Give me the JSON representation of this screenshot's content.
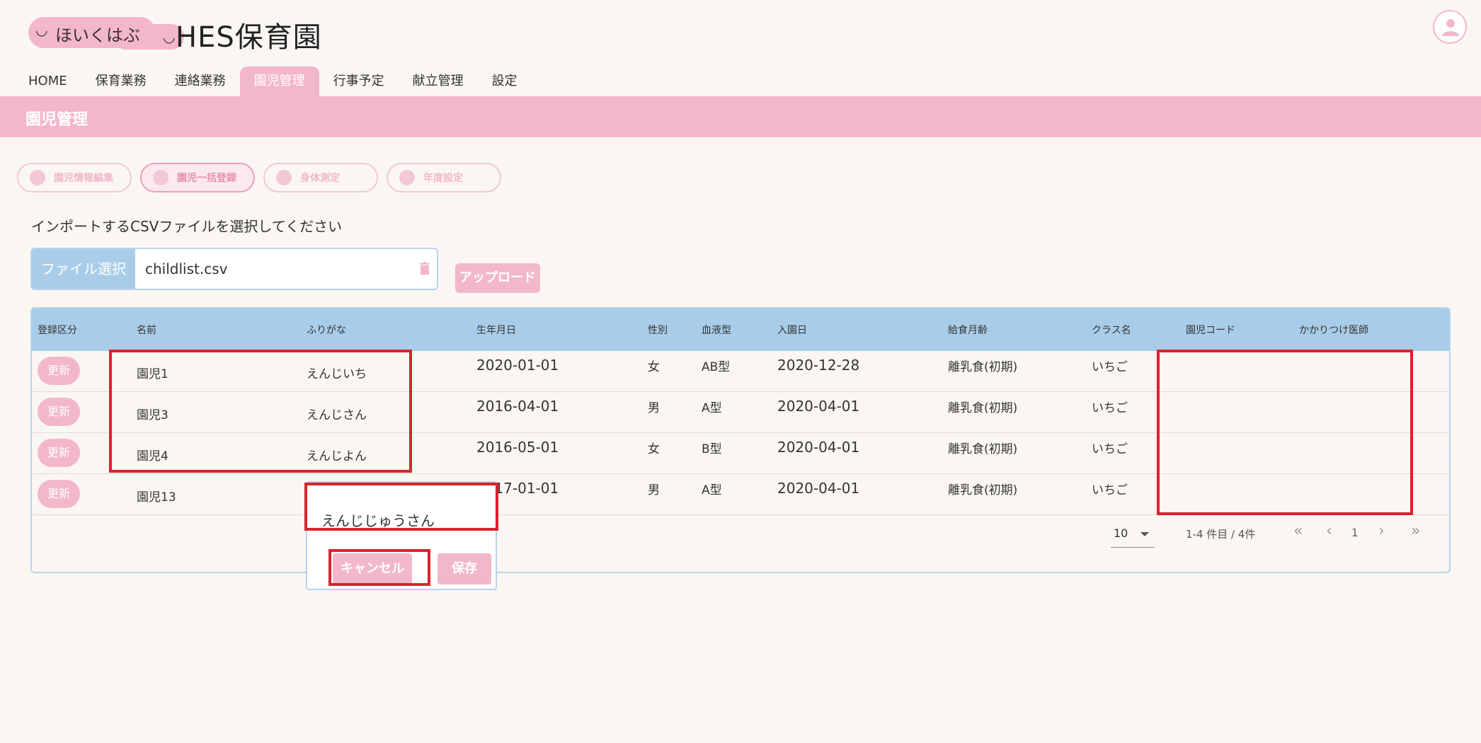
{
  "header": {
    "logo_text": "ほいくはぶ",
    "app_title": "HES保育園"
  },
  "nav": {
    "items": [
      {
        "label": "HOME"
      },
      {
        "label": "保育業務"
      },
      {
        "label": "連絡業務"
      },
      {
        "label": "園児管理",
        "active": true
      },
      {
        "label": "行事予定"
      },
      {
        "label": "献立管理"
      },
      {
        "label": "設定"
      }
    ]
  },
  "page_title": "園児管理",
  "subtabs": [
    {
      "label": "園児情報編集"
    },
    {
      "label": "園児一括登録",
      "active": true
    },
    {
      "label": "身体測定"
    },
    {
      "label": "年度設定"
    }
  ],
  "instruction": "インポートするCSVファイルを選択してください",
  "file": {
    "button_label": "ファイル選択",
    "file_name": "childlist.csv",
    "upload_label": "アップロード"
  },
  "table": {
    "headers": [
      "登録区分",
      "名前",
      "ふりがな",
      "生年月日",
      "性別",
      "血液型",
      "入園日",
      "給食月齢",
      "クラス名",
      "園児コード",
      "かかりつけ医師"
    ],
    "rows": [
      {
        "action": "更新",
        "name": "園児1",
        "kana": "えんじいち",
        "birth": "2020-01-01",
        "sex": "女",
        "blood": "AB型",
        "enroll": "2020-12-28",
        "meal": "離乳食(初期)",
        "class": "いちご",
        "code": "",
        "doctor": ""
      },
      {
        "action": "更新",
        "name": "園児3",
        "kana": "えんじさん",
        "birth": "2016-04-01",
        "sex": "男",
        "blood": "A型",
        "enroll": "2020-04-01",
        "meal": "離乳食(初期)",
        "class": "いちご",
        "code": "",
        "doctor": ""
      },
      {
        "action": "更新",
        "name": "園児4",
        "kana": "えんじよん",
        "birth": "2016-05-01",
        "sex": "女",
        "blood": "B型",
        "enroll": "2020-04-01",
        "meal": "離乳食(初期)",
        "class": "いちご",
        "code": "",
        "doctor": ""
      },
      {
        "action": "更新",
        "name": "園児13",
        "kana": "",
        "birth": "2017-01-01",
        "sex": "男",
        "blood": "A型",
        "enroll": "2020-04-01",
        "meal": "離乳食(初期)",
        "class": "いちご",
        "code": "",
        "doctor": ""
      }
    ]
  },
  "pagination": {
    "per_page": "10",
    "range_text": "1-4 件目 / 4件",
    "current_page": "1"
  },
  "popup": {
    "input_value": "えんじじゅうさん",
    "cancel_label": "キャンセル",
    "save_label": "保存"
  },
  "colors": {
    "accent_pink": "#f3b7cb",
    "header_blue": "#a9cde9",
    "highlight_red": "#d9232d"
  }
}
